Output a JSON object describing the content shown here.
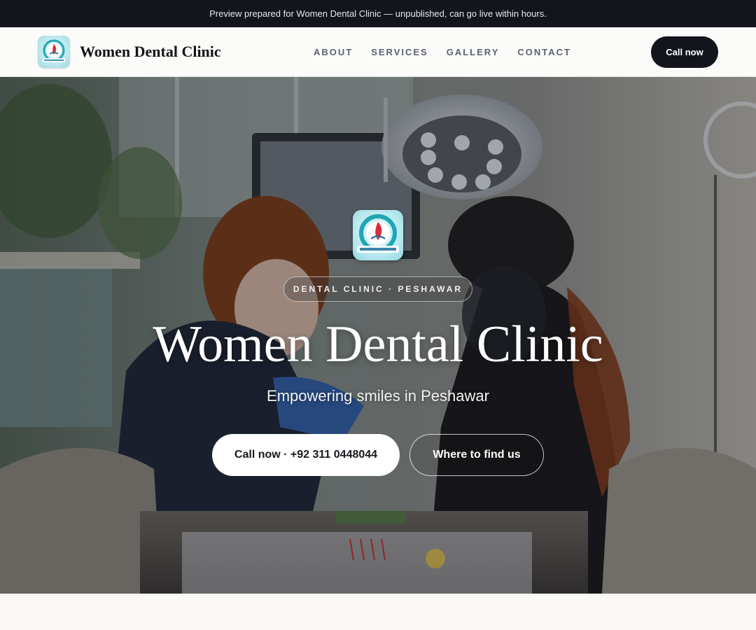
{
  "banner": {
    "text": "Preview prepared for Women Dental Clinic — unpublished, can go live within hours."
  },
  "header": {
    "brand_name": "Women Dental Clinic",
    "logo_text": "ONLY FOR LADIES",
    "nav": [
      {
        "label": "ABOUT"
      },
      {
        "label": "SERVICES"
      },
      {
        "label": "GALLERY"
      },
      {
        "label": "CONTACT"
      }
    ],
    "cta_label": "Call now"
  },
  "hero": {
    "logo_text": "ONLY FOR LADIES",
    "tag": "DENTAL CLINIC · PESHAWAR",
    "title": "Women Dental Clinic",
    "subtitle": "Empowering smiles in Peshawar",
    "primary_button": "Call now · +92 311 0448044",
    "secondary_button": "Where to find us"
  },
  "colors": {
    "dark": "#12151c",
    "accent_teal": "#1fa6b3",
    "accent_red": "#d92b3a"
  }
}
